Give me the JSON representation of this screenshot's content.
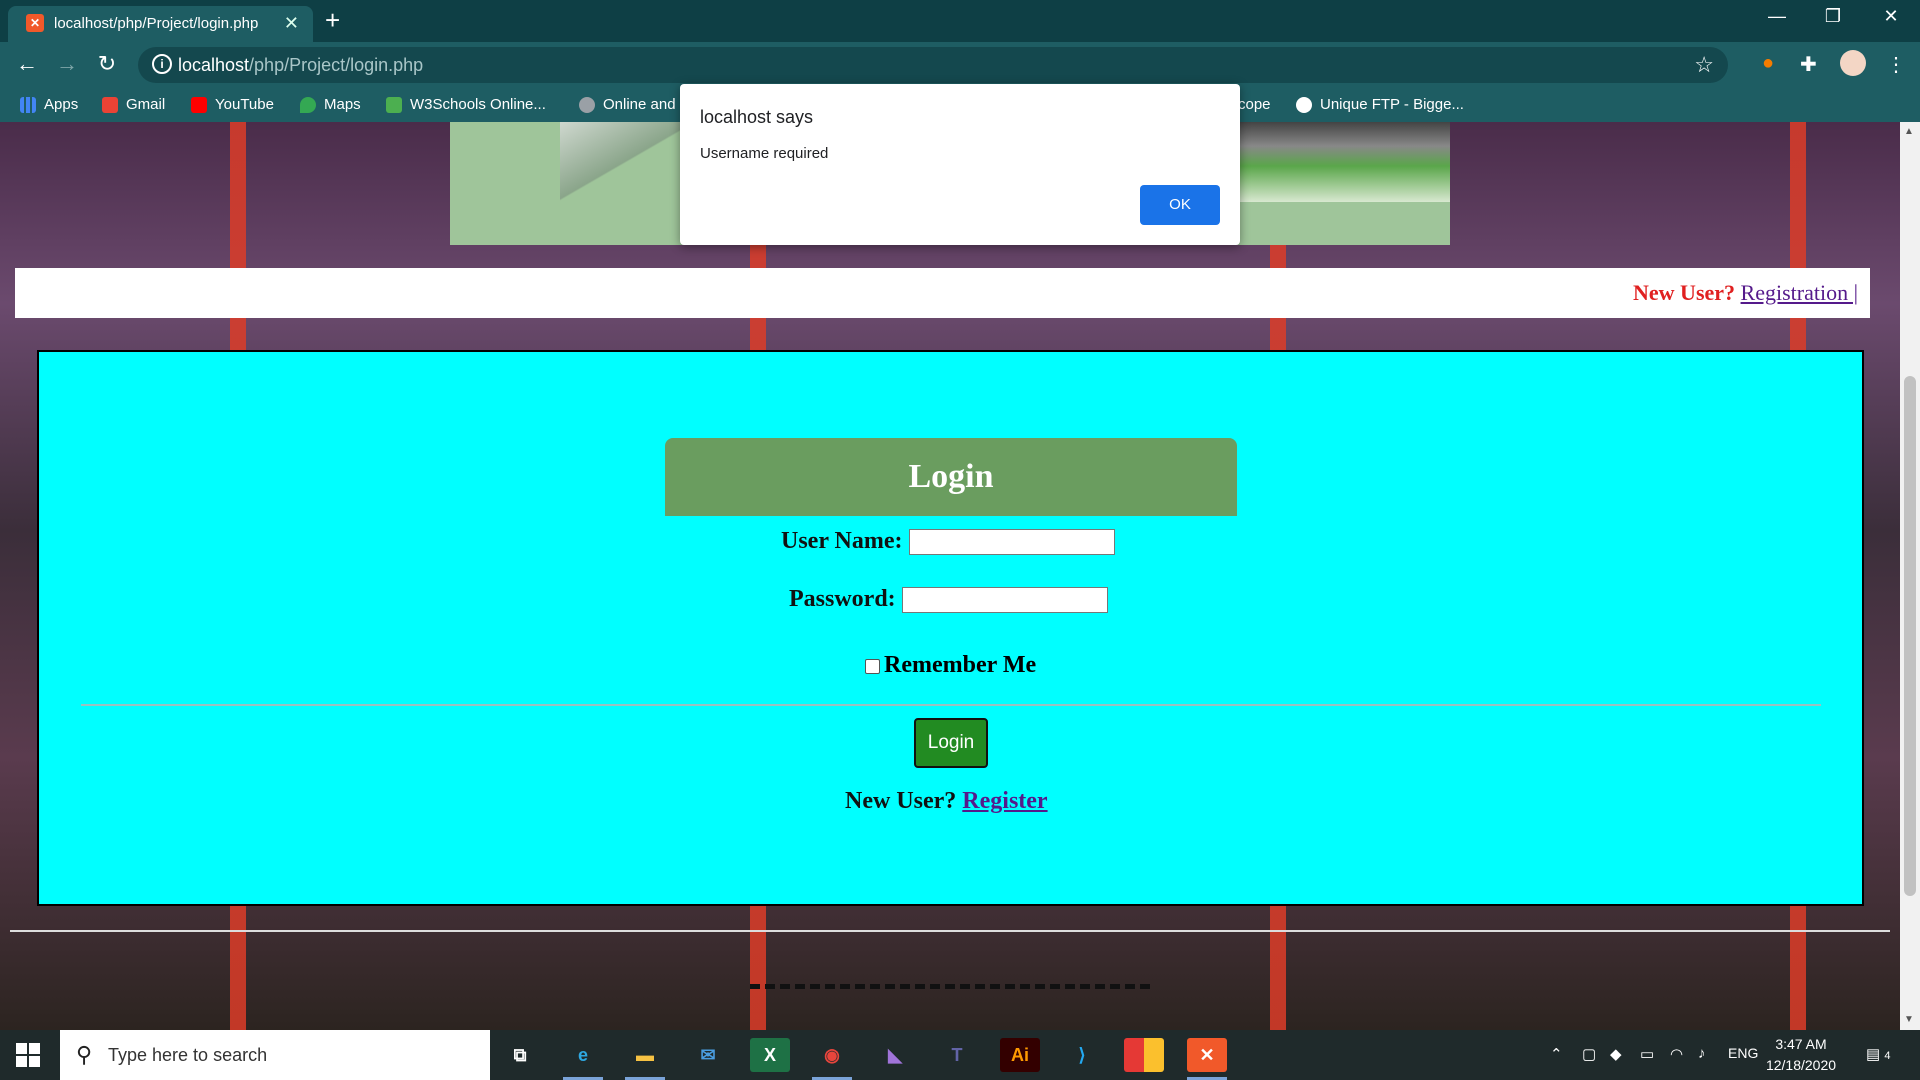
{
  "browser": {
    "tab_title": "localhost/php/Project/login.php",
    "tab_favicon": "xampp-icon",
    "url_host": "localhost",
    "url_path": "/php/Project/login.php",
    "bookmarks": [
      {
        "label": "Apps",
        "icon": "apps-grid-icon",
        "color": "#4285f4"
      },
      {
        "label": "Gmail",
        "icon": "gmail-icon",
        "color": "#ea4335"
      },
      {
        "label": "YouTube",
        "icon": "youtube-icon",
        "color": "#ff0000"
      },
      {
        "label": "Maps",
        "icon": "maps-icon",
        "color": "#34a853"
      },
      {
        "label": "W3Schools Online...",
        "icon": "w3schools-icon",
        "color": "#4caf50"
      },
      {
        "label": "Online and",
        "icon": "globe-icon",
        "color": "#9aa0a6"
      },
      {
        "label": "cope",
        "icon": "",
        "color": ""
      },
      {
        "label": "Unique FTP - Bigge...",
        "icon": "globe-icon",
        "color": "#ffffff"
      }
    ]
  },
  "page": {
    "topbar": {
      "new_user_label": "New User?",
      "registration_link": "Registration |"
    },
    "login": {
      "header": "Login",
      "username_label": "User Name:",
      "password_label": "Password:",
      "remember_label": "Remember Me",
      "button_label": "Login",
      "new_user_label": "New User?",
      "register_link": "Register"
    }
  },
  "dialog": {
    "title": "localhost says",
    "message": "Username required",
    "ok_label": "OK"
  },
  "taskbar": {
    "search_placeholder": "Type here to search",
    "language": "ENG",
    "time": "3:47 AM",
    "date": "12/18/2020",
    "notification_count": "4"
  },
  "colors": {
    "chrome": "#1e5d63",
    "panel_bg": "#00ffff",
    "header_bg": "#6a9d5f",
    "login_button": "#228b22",
    "ok_button": "#1a73e8"
  }
}
